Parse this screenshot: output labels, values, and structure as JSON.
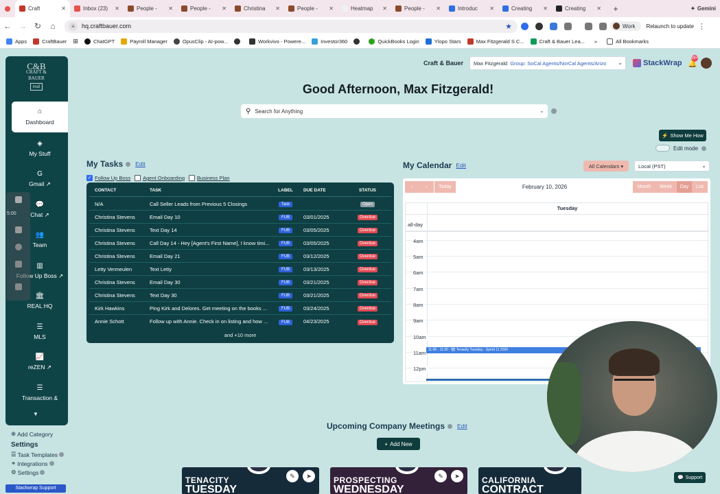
{
  "browser": {
    "tabs": [
      {
        "label": "Craft",
        "color": "#c0392b"
      },
      {
        "label": "Inbox (23)",
        "color": "#e5534b"
      },
      {
        "label": "People -",
        "color": "#8a4b2c"
      },
      {
        "label": "People -",
        "color": "#8a4b2c"
      },
      {
        "label": "Christina",
        "color": "#8a4b2c"
      },
      {
        "label": "People -",
        "color": "#8a4b2c"
      },
      {
        "label": "Heatmap",
        "color": "#f1f1f1"
      },
      {
        "label": "People -",
        "color": "#8a4b2c"
      },
      {
        "label": "Introduc",
        "color": "#2e6fe0"
      },
      {
        "label": "Creating",
        "color": "#2e6fe0"
      },
      {
        "label": "Creating",
        "color": "#222222"
      }
    ],
    "gemini_label": "Gemini",
    "url": "hq.craftbauer.com",
    "profile_label": "Work",
    "relaunch_label": "Relaunch to update",
    "bookmarks": [
      {
        "label": "Apps",
        "color": "#4285f4"
      },
      {
        "label": "CraftBauer",
        "color": "#c0392b"
      },
      {
        "label": "ChatGPT",
        "color": "#111111"
      },
      {
        "label": "Payroll Manager",
        "color": "#e6a700"
      },
      {
        "label": "OpusClip - AI-pow...",
        "color": "#444444"
      },
      {
        "label": "Workvivo - Powere...",
        "color": "#333333"
      },
      {
        "label": "Investor360",
        "color": "#3aa0d8"
      },
      {
        "label": "QuickBooks Login",
        "color": "#2ca01c"
      },
      {
        "label": "Ylopo Stars",
        "color": "#1d6fd8"
      },
      {
        "label": "Max Fitzgerald S C...",
        "color": "#c0392b"
      },
      {
        "label": "Craft & Bauer Lea...",
        "color": "#0f9d58"
      }
    ],
    "all_bookmarks_label": "All Bookmarks"
  },
  "header": {
    "brand": "Craft & Bauer",
    "user_name": "Max Fitzgerald",
    "group_label": "Group: SoCal Agents/NorCal Agents/Arizo",
    "app_logo": "StackWrap",
    "notification_count": "99+",
    "greeting": "Good Afternoon, Max Fitzgerald!",
    "search_placeholder": "Search for Anything",
    "show_me_how": "Show Me How",
    "edit_mode": "Edit mode"
  },
  "sidebar": {
    "logo_mono": "C&B",
    "logo_line1": "CRAFT & BAUER",
    "logo_line2": "real",
    "items": [
      {
        "label": "Dashboard",
        "icon": "home-icon"
      },
      {
        "label": "My Stuff",
        "icon": "layers-icon"
      },
      {
        "label": "Gmail",
        "icon": "google-icon",
        "external": true
      },
      {
        "label": "Chat",
        "icon": "chat-icon",
        "external": true
      },
      {
        "label": "Team",
        "icon": "team-icon"
      },
      {
        "label": "Follow Up Boss",
        "icon": "chart-icon",
        "external": true
      },
      {
        "label": "REAL HQ",
        "icon": "building-icon"
      },
      {
        "label": "MLS",
        "icon": "list-icon"
      },
      {
        "label": "reZEN",
        "icon": "chart-line-icon",
        "external": true
      },
      {
        "label": "Transaction &",
        "icon": "list-icon"
      }
    ],
    "recorder_time": "5:00",
    "add_category": "Add Category",
    "settings_heading": "Settings",
    "settings_links": [
      "Task Templates",
      "Integrations",
      "Settings"
    ],
    "support_label": "Stackwrap Support"
  },
  "tasks": {
    "heading": "My Tasks",
    "edit_label": "Edit",
    "filters": [
      {
        "label": "Follow Up Boss",
        "checked": true
      },
      {
        "label": "Agent Onboarding",
        "checked": false
      },
      {
        "label": "Business Plan",
        "checked": false
      }
    ],
    "columns": [
      "CONTACT",
      "TASK",
      "LABEL",
      "DUE DATE",
      "STATUS"
    ],
    "rows": [
      {
        "contact": "N/A",
        "task": "Call Seller Leads from Previous 5 Closings",
        "label": "Task",
        "due": "",
        "status": "Open"
      },
      {
        "contact": "Christina Stevens",
        "task": "Email Day 10",
        "label": "FUB",
        "due": "03/01/2025",
        "status": "Overdue"
      },
      {
        "contact": "Christina Stevens",
        "task": "Text Day 14",
        "label": "FUB",
        "due": "03/05/2025",
        "status": "Overdue"
      },
      {
        "contact": "Christina Stevens",
        "task": "Call Day 14 - Hey [Agent's First Name], I know timi...",
        "label": "FUB",
        "due": "03/05/2025",
        "status": "Overdue"
      },
      {
        "contact": "Christina Stevens",
        "task": "Email Day 21",
        "label": "FUB",
        "due": "03/12/2025",
        "status": "Overdue"
      },
      {
        "contact": "Letty Vermeulen",
        "task": "Text Letty",
        "label": "FUB",
        "due": "03/13/2025",
        "status": "Overdue"
      },
      {
        "contact": "Christina Stevens",
        "task": "Email Day 30",
        "label": "FUB",
        "due": "03/21/2025",
        "status": "Overdue"
      },
      {
        "contact": "Christina Stevens",
        "task": "Text Day 30",
        "label": "FUB",
        "due": "03/21/2025",
        "status": "Overdue"
      },
      {
        "contact": "Kirk Hawkins",
        "task": "Ping Kirk and Delores. Get meeting on the books ...",
        "label": "FUB",
        "due": "03/24/2025",
        "status": "Overdue"
      },
      {
        "contact": "Annie Schott",
        "task": "Follow up with Annie. Check in on listing and how ...",
        "label": "FUB",
        "due": "04/23/2025",
        "status": "Overdue"
      }
    ],
    "more_label": "and +10 more"
  },
  "calendar": {
    "heading": "My Calendar",
    "edit_label": "Edit",
    "all_calendars": "All Calendars",
    "timezone": "Local (PST)",
    "prev": "‹",
    "next": "›",
    "today": "Today",
    "views": [
      "Month",
      "Week",
      "Day",
      "List"
    ],
    "date_title": "February 10, 2026",
    "day_header": "Tuesday",
    "all_day": "all-day",
    "hours": [
      "4am",
      "5am",
      "6am",
      "7am",
      "8am",
      "9am",
      "10am",
      "11am",
      "12pm"
    ],
    "event_text": "11:00 - 11:30 - 🏗 Tenacity Tuesday - Sprint 11 2026"
  },
  "meetings": {
    "heading": "Upcoming Company Meetings",
    "edit_label": "Edit",
    "add_new": "Add New",
    "cards": [
      {
        "line1": "TENACITY",
        "line2": "TUESDAY",
        "bg": "#1c2c44"
      },
      {
        "line1": "PROSPECTING",
        "line2": "WEDNESDAY",
        "bg": "#3b2236"
      },
      {
        "line1": "CALIFORNIA",
        "line2": "CONTRACT",
        "bg": "#1f2a3a"
      }
    ]
  },
  "webcam_overlay_label": "Support"
}
